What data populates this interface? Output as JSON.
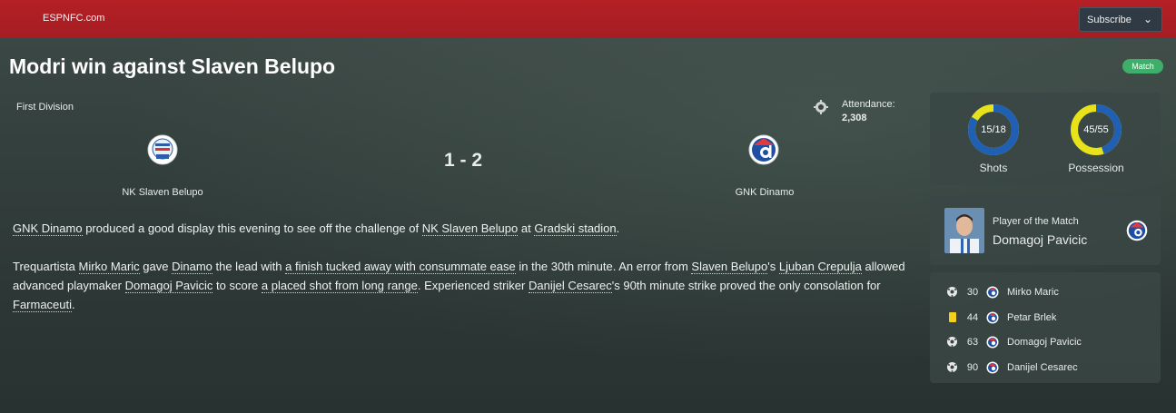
{
  "header": {
    "brand": "ESPNFC.com",
    "subscribe_label": "Subscribe"
  },
  "page": {
    "title": "Modri win against Slaven Belupo",
    "badge": "Match"
  },
  "match": {
    "competition": "First Division",
    "attendance_label": "Attendance:",
    "attendance": "2,308",
    "home_team": "NK Slaven Belupo",
    "away_team": "GNK Dinamo",
    "score": "1 - 2"
  },
  "report": {
    "p1": [
      {
        "text": "GNK Dinamo",
        "link": true
      },
      {
        "text": " produced a good display this evening to see off the challenge of ",
        "link": false
      },
      {
        "text": "NK Slaven Belupo",
        "link": true
      },
      {
        "text": " at ",
        "link": false
      },
      {
        "text": "Gradski stadion",
        "link": true
      },
      {
        "text": ".",
        "link": false
      }
    ],
    "p2": [
      {
        "text": "Trequartista ",
        "link": false
      },
      {
        "text": "Mirko Maric",
        "link": true
      },
      {
        "text": " gave ",
        "link": false
      },
      {
        "text": "Dinamo",
        "link": true
      },
      {
        "text": " the lead with ",
        "link": false
      },
      {
        "text": "a finish tucked away with consummate ease",
        "link": true
      },
      {
        "text": " in the 30th minute. An error from ",
        "link": false
      },
      {
        "text": "Slaven Belupo",
        "link": true
      },
      {
        "text": "'s ",
        "link": false
      },
      {
        "text": "Ljuban Crepulja",
        "link": true
      },
      {
        "text": " allowed advanced playmaker ",
        "link": false
      },
      {
        "text": "Domagoj Pavicic",
        "link": true
      },
      {
        "text": " to score ",
        "link": false
      },
      {
        "text": "a placed shot from long range",
        "link": true
      },
      {
        "text": ". Experienced striker ",
        "link": false
      },
      {
        "text": "Danijel Cesarec",
        "link": true
      },
      {
        "text": "'s 90th minute strike proved the only consolation for ",
        "link": false
      },
      {
        "text": "Farmaceuti",
        "link": true
      },
      {
        "text": ".",
        "link": false
      }
    ]
  },
  "stats": {
    "shots": {
      "label": "Shots",
      "value": "15/18",
      "home": 15,
      "total": 18
    },
    "possession": {
      "label": "Possession",
      "value": "45/55",
      "home": 45,
      "total": 55
    }
  },
  "potm": {
    "label": "Player of the Match",
    "name": "Domagoj Pavicic"
  },
  "events": [
    {
      "type": "goal",
      "icon": "ball-icon",
      "minute": "30",
      "player": "Mirko Maric"
    },
    {
      "type": "yellow",
      "icon": "yellow-card-icon",
      "minute": "44",
      "player": "Petar Brlek"
    },
    {
      "type": "goal",
      "icon": "ball-icon",
      "minute": "63",
      "player": "Domagoj Pavicic"
    },
    {
      "type": "goal",
      "icon": "ball-icon",
      "minute": "90",
      "player": "Danijel Cesarec"
    }
  ],
  "colors": {
    "accent_red": "#b42026",
    "badge_green": "#3fae6a",
    "donut_blue": "#1f5fb4",
    "donut_yellow": "#e8e21a"
  }
}
